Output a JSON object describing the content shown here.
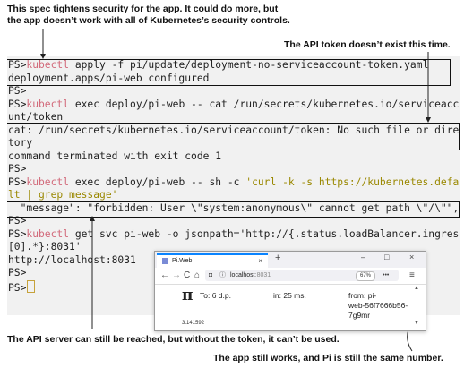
{
  "annotations": {
    "top_left": "This spec tightens security for the app. It could do more, but\nthe app doesn’t work with all of Kubernetes’s security controls.",
    "top_right": "The API token doesn’t exist this time.",
    "bottom_left": "The API server can still be reached, but without the token, it can’t be used.",
    "bottom_right": "The app still works, and Pi is still the same number."
  },
  "terminal": {
    "lines": [
      {
        "parts": [
          {
            "t": "PS>",
            "c": "prompt"
          },
          {
            "t": "kubectl",
            "c": "cmd-kw"
          },
          {
            "t": " apply -f pi/update/deployment-no-serviceaccount-token.yaml",
            "c": ""
          }
        ]
      },
      {
        "parts": [
          {
            "t": "deployment.apps/pi-web configured",
            "c": ""
          }
        ]
      },
      {
        "parts": [
          {
            "t": "PS>",
            "c": "prompt"
          }
        ]
      },
      {
        "parts": [
          {
            "t": "PS>",
            "c": "prompt"
          },
          {
            "t": "kubectl",
            "c": "cmd-kw"
          },
          {
            "t": " exec deploy/pi-web -- cat /run/secrets/kubernetes.io/serviceacco",
            "c": ""
          }
        ]
      },
      {
        "parts": [
          {
            "t": "unt/token",
            "c": ""
          }
        ]
      },
      {
        "parts": [
          {
            "t": "cat: /run/secrets/kubernetes.io/serviceaccount/token: No such file or direc",
            "c": ""
          }
        ]
      },
      {
        "parts": [
          {
            "t": "tory",
            "c": ""
          }
        ]
      },
      {
        "parts": [
          {
            "t": "command terminated with exit code 1",
            "c": ""
          }
        ]
      },
      {
        "parts": [
          {
            "t": "PS>",
            "c": "prompt"
          }
        ]
      },
      {
        "parts": [
          {
            "t": "PS>",
            "c": "prompt"
          },
          {
            "t": "kubectl",
            "c": "cmd-kw"
          },
          {
            "t": " exec deploy/pi-web -- sh -c ",
            "c": ""
          },
          {
            "t": "'curl -k -s https://kubernetes.defau",
            "c": "str"
          }
        ]
      },
      {
        "parts": [
          {
            "t": "lt | grep message'",
            "c": "str"
          }
        ]
      },
      {
        "parts": [
          {
            "t": "  \"message\": \"forbidden: User \\\"system:anonymous\\\" cannot get path \\\"/\\\"\",",
            "c": ""
          }
        ]
      },
      {
        "parts": [
          {
            "t": "PS>",
            "c": "prompt"
          }
        ]
      },
      {
        "parts": [
          {
            "t": "PS>",
            "c": "prompt"
          },
          {
            "t": "kubectl",
            "c": "cmd-kw"
          },
          {
            "t": " get svc pi-web -o jsonpath='http://{.status.loadBalancer.ingress",
            "c": ""
          }
        ]
      },
      {
        "parts": [
          {
            "t": "[0].*}:8031'",
            "c": ""
          }
        ]
      },
      {
        "parts": [
          {
            "t": "http://localhost:8031",
            "c": ""
          }
        ]
      },
      {
        "parts": [
          {
            "t": "PS>",
            "c": "prompt"
          }
        ]
      },
      {
        "parts": [
          {
            "t": "PS>",
            "c": "prompt"
          }
        ]
      }
    ]
  },
  "browser": {
    "tab_title": "Pi.Web",
    "tab_close": "×",
    "new_tab": "+",
    "win_minimize": "–",
    "win_maximize": "□",
    "win_close": "×",
    "back": "←",
    "forward": "→",
    "reload": "C",
    "home": "⌂",
    "lock": "◘",
    "info": "ⓘ",
    "url_host": "localhost",
    "url_port": ":8031",
    "zoom": "67%",
    "more": "•••",
    "menu": "≡",
    "pi_symbol": "π",
    "to_label": "To: 6 d.p.",
    "in_label": "in: 25 ms.",
    "from_label": "from: pi-",
    "from_host": "web-56f7666b56-7g9mr",
    "pi_value": "3.141592"
  }
}
